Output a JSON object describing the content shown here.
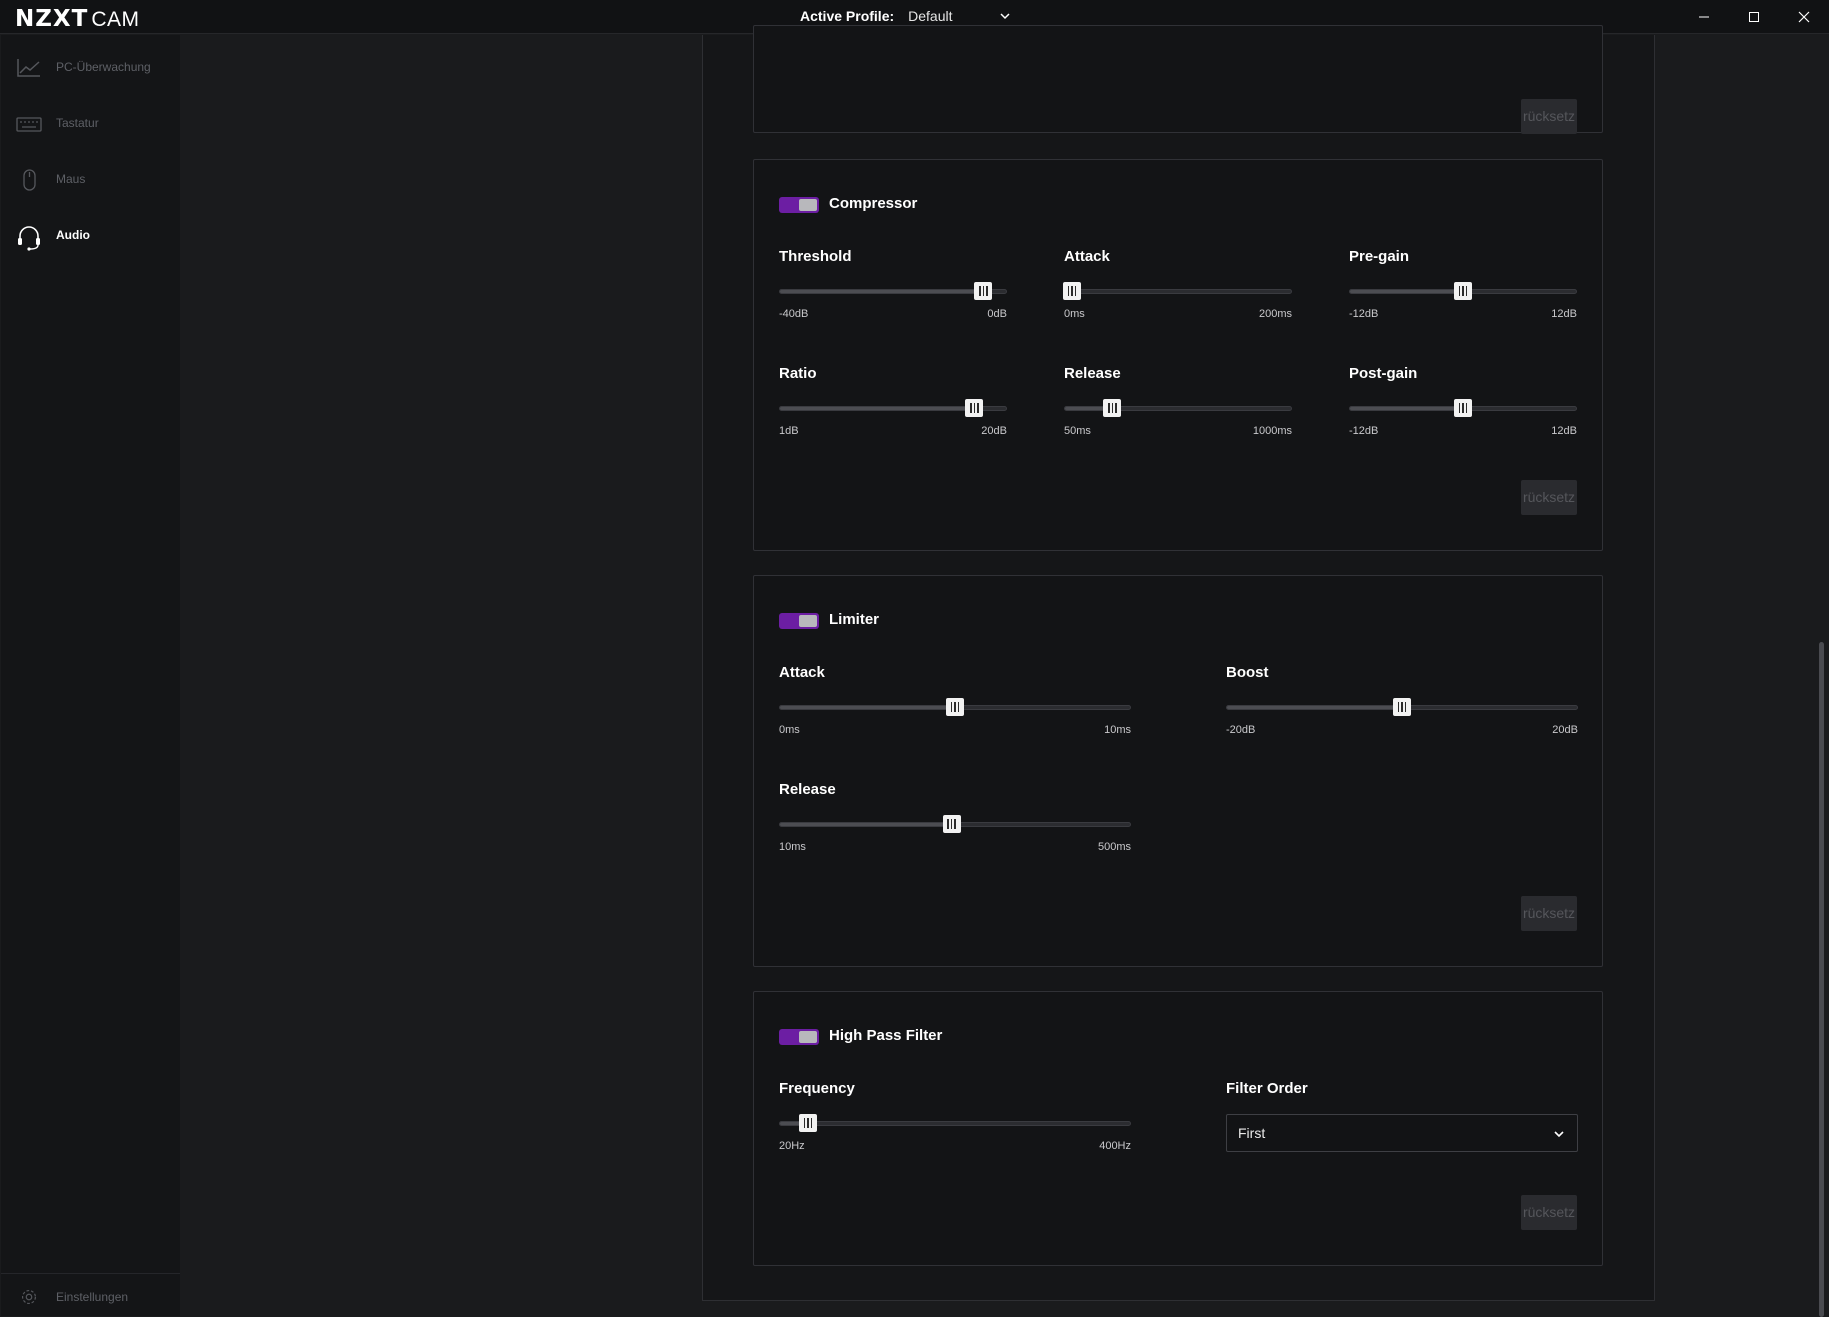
{
  "app": {
    "logo_main": "NZXT",
    "logo_sub": "CAM",
    "profile_label": "Active Profile:",
    "profile_value": "Default"
  },
  "window_controls": {
    "minimize": "minimize-icon",
    "maximize": "maximize-icon",
    "close": "close-icon"
  },
  "sidebar": {
    "items": [
      {
        "label": "PC-Überwachung",
        "icon": "chart-line-icon",
        "active": false
      },
      {
        "label": "Tastatur",
        "icon": "keyboard-icon",
        "active": false
      },
      {
        "label": "Maus",
        "icon": "mouse-icon",
        "active": false
      },
      {
        "label": "Audio",
        "icon": "headset-icon",
        "active": true
      }
    ],
    "settings_label": "Einstellungen",
    "settings_icon": "gear-icon"
  },
  "sections": {
    "top_card": {
      "reset_label": "rücksetz"
    },
    "compressor": {
      "title": "Compressor",
      "enabled": true,
      "threshold": {
        "label": "Threshold",
        "min": "-40dB",
        "max": "0dB",
        "value_pct": 90
      },
      "attack": {
        "label": "Attack",
        "min": "0ms",
        "max": "200ms",
        "value_pct": 3
      },
      "pregain": {
        "label": "Pre-gain",
        "min": "-12dB",
        "max": "12dB",
        "value_pct": 50
      },
      "ratio": {
        "label": "Ratio",
        "min": "1dB",
        "max": "20dB",
        "value_pct": 86
      },
      "release": {
        "label": "Release",
        "min": "50ms",
        "max": "1000ms",
        "value_pct": 21
      },
      "postgain": {
        "label": "Post-gain",
        "min": "-12dB",
        "max": "12dB",
        "value_pct": 50
      },
      "reset_label": "rücksetz"
    },
    "limiter": {
      "title": "Limiter",
      "enabled": true,
      "attack": {
        "label": "Attack",
        "min": "0ms",
        "max": "10ms",
        "value_pct": 50
      },
      "boost": {
        "label": "Boost",
        "min": "-20dB",
        "max": "20dB",
        "value_pct": 50
      },
      "release": {
        "label": "Release",
        "min": "10ms",
        "max": "500ms",
        "value_pct": 49
      },
      "reset_label": "rücksetz"
    },
    "highpass": {
      "title": "High Pass Filter",
      "enabled": true,
      "frequency": {
        "label": "Frequency",
        "min": "20Hz",
        "max": "400Hz",
        "value_pct": 8
      },
      "filter_order_label": "Filter Order",
      "filter_order_value": "First",
      "reset_label": "rücksetz"
    }
  },
  "colors": {
    "accent": "#6c1ea3",
    "background": "#1a1b1d",
    "card_border": "#303136"
  }
}
